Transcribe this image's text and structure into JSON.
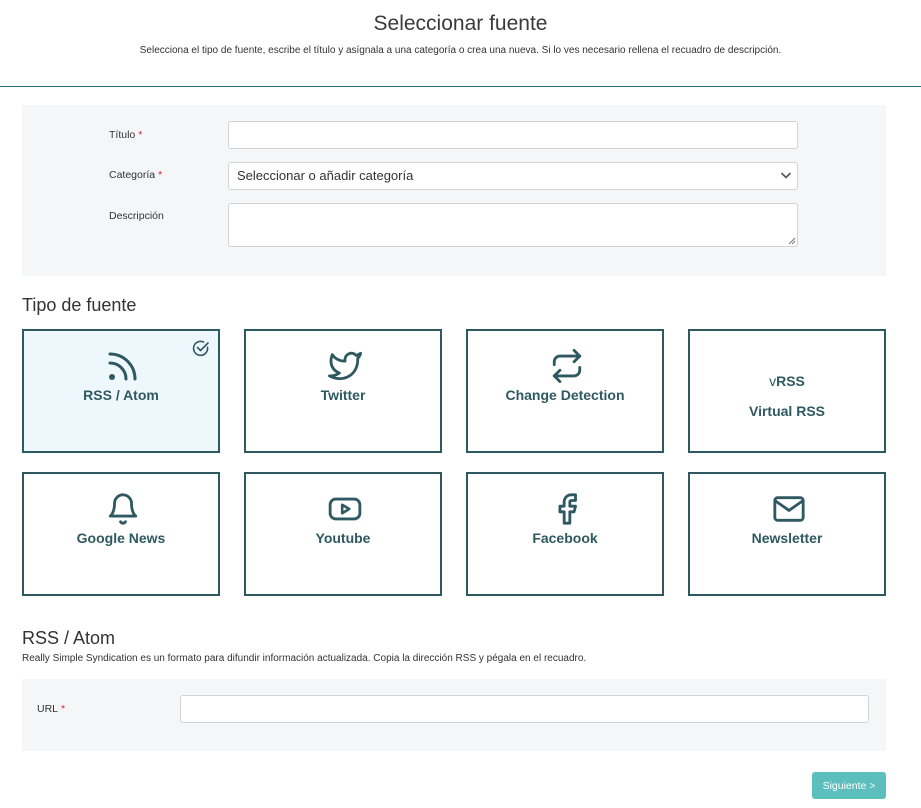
{
  "header": {
    "title": "Seleccionar fuente",
    "subtitle": "Selecciona el tipo de fuente, escribe el título y asígnala a una categoría o crea una nueva. Si lo ves necesario rellena el recuadro de descripción."
  },
  "form": {
    "title_label": "Título",
    "title_value": "",
    "category_label": "Categoría",
    "category_value": "Seleccionar o añadir categoría",
    "description_label": "Descripción",
    "description_value": "",
    "required_mark": "*"
  },
  "source_types": {
    "heading": "Tipo de fuente",
    "items": [
      {
        "label": "RSS / Atom",
        "icon": "rss-icon",
        "selected": true
      },
      {
        "label": "Twitter",
        "icon": "twitter-icon",
        "selected": false
      },
      {
        "label": "Change Detection",
        "icon": "exchange-arrows-icon",
        "selected": false
      },
      {
        "label": "Virtual RSS",
        "icon": "vrss-logo",
        "mark_prefix": "v",
        "mark_main": "RSS",
        "selected": false
      },
      {
        "label": "Google News",
        "icon": "bell-icon",
        "selected": false
      },
      {
        "label": "Youtube",
        "icon": "youtube-icon",
        "selected": false
      },
      {
        "label": "Facebook",
        "icon": "facebook-icon",
        "selected": false
      },
      {
        "label": "Newsletter",
        "icon": "envelope-icon",
        "selected": false
      }
    ]
  },
  "rss_section": {
    "heading": "RSS / Atom",
    "description": "Really Simple Syndication es un formato para difundir información actualizada. Copia la dirección RSS y pégala en el recuadro.",
    "url_label": "URL",
    "url_value": ""
  },
  "footer": {
    "next_label": "Siguiente >"
  },
  "colors": {
    "accent": "#5cbfbd",
    "tile_border": "#2f5961",
    "header_rule": "#2c6f7d",
    "required": "#d9232e",
    "selected_tile_bg": "#eef7fb"
  }
}
